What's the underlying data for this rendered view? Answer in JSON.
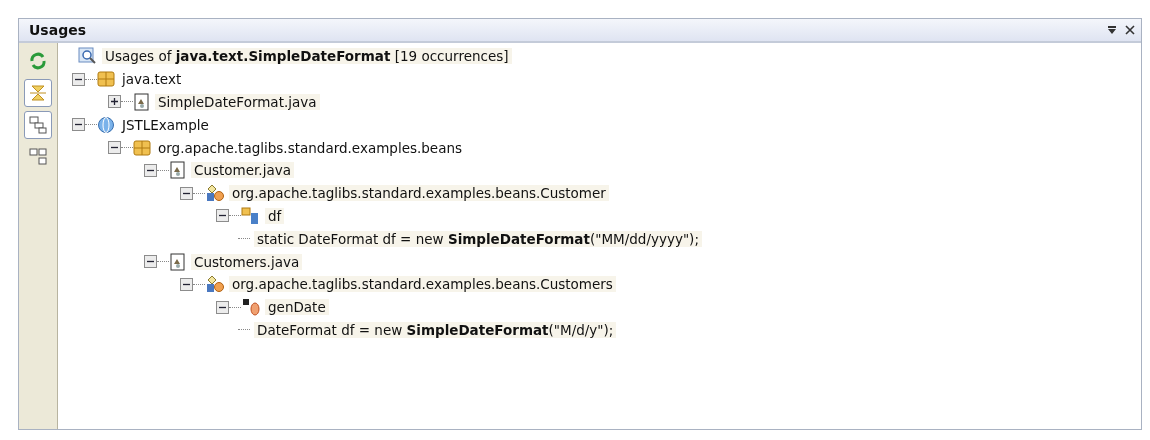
{
  "panel": {
    "title": "Usages"
  },
  "toolbar": [
    {
      "kind": "refresh",
      "selected": false
    },
    {
      "kind": "collapse",
      "selected": true
    },
    {
      "kind": "logical",
      "selected": true
    },
    {
      "kind": "physical",
      "selected": false
    }
  ],
  "tree": {
    "kind": "search",
    "label": "Usages of **java.text.SimpleDateFormat** [19 occurrences]",
    "children": [
      {
        "kind": "package",
        "label": "java.text",
        "expanded": true,
        "children": [
          {
            "kind": "file",
            "label": "SimpleDateFormat.java",
            "expanded": false
          }
        ]
      },
      {
        "kind": "project",
        "label": "JSTLExample",
        "expanded": true,
        "children": [
          {
            "kind": "package",
            "label": "org.apache.taglibs.standard.examples.beans",
            "expanded": true,
            "children": [
              {
                "kind": "file",
                "label": "Customer.java",
                "expanded": true,
                "children": [
                  {
                    "kind": "class",
                    "label": "org.apache.taglibs.standard.examples.beans.Customer",
                    "expanded": true,
                    "children": [
                      {
                        "kind": "field",
                        "label": "df",
                        "expanded": true,
                        "children": [
                          {
                            "kind": "code",
                            "label": "static DateFormat df = new **SimpleDateFormat**(\"MM/dd/yyyy\");"
                          }
                        ]
                      }
                    ]
                  }
                ]
              },
              {
                "kind": "file",
                "label": "Customers.java",
                "expanded": true,
                "children": [
                  {
                    "kind": "class",
                    "label": "org.apache.taglibs.standard.examples.beans.Customers",
                    "expanded": true,
                    "children": [
                      {
                        "kind": "method",
                        "label": "genDate",
                        "expanded": true,
                        "children": [
                          {
                            "kind": "code",
                            "label": "DateFormat df = new **SimpleDateFormat**(\"M/d/y\");"
                          }
                        ]
                      }
                    ]
                  }
                ]
              }
            ]
          }
        ]
      }
    ]
  }
}
